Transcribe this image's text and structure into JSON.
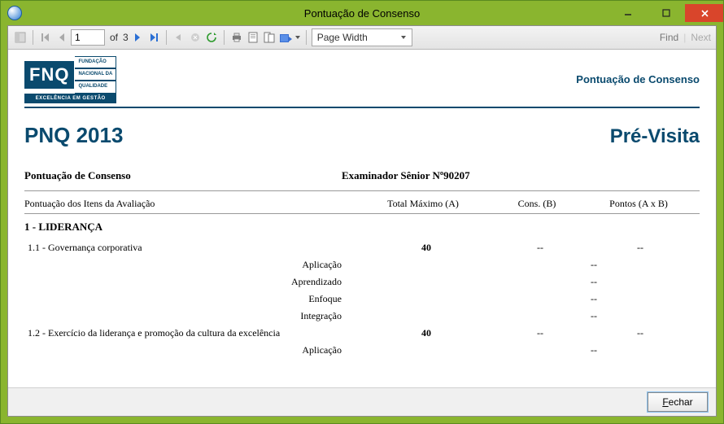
{
  "window": {
    "title": "Pontuação de Consenso"
  },
  "toolbar": {
    "page_current": "1",
    "page_of": "of",
    "page_total": "3",
    "zoom": "Page Width",
    "find": "Find",
    "next": "Next"
  },
  "report": {
    "header_link": "Pontuação de Consenso",
    "logo_main": "FNQ",
    "logo_sub1": "FUNDAÇÃO",
    "logo_sub2": "NACIONAL DA",
    "logo_sub3": "QUALIDADE",
    "logo_bottom": "EXCELÊNCIA EM GESTÃO",
    "title_left": "PNQ 2013",
    "title_right": "Pré-Visita",
    "sub_left": "Pontuação de Consenso",
    "sub_right": "Examinador Sênior Nº90207",
    "columns": {
      "c1": "Pontuação dos Itens da Avaliação",
      "c2": "Total Máximo (A)",
      "c3": "Cons. (B)",
      "c4": "Pontos (A x B)"
    },
    "section1": "1 - LIDERANÇA",
    "rows": [
      {
        "label": "1.1 - Governança corporativa",
        "a": "40",
        "b": "--",
        "ab": "--"
      }
    ],
    "sub1": [
      "Aplicação",
      "Aprendizado",
      "Enfoque",
      "Integração"
    ],
    "dash": "--",
    "row2": {
      "label": "1.2 - Exercício da liderança e promoção da cultura da excelência",
      "a": "40",
      "b": "--",
      "ab": "--"
    },
    "sub2": [
      "Aplicação"
    ]
  },
  "footer": {
    "close": "Fechar",
    "close_u": "F"
  }
}
